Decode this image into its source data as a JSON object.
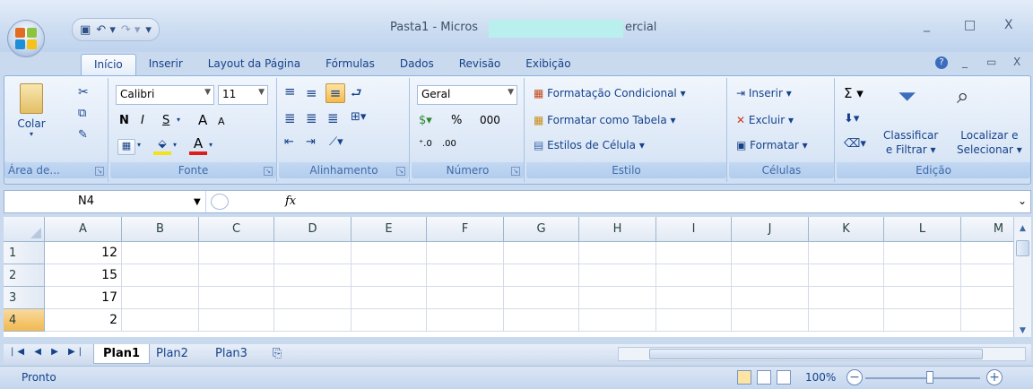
{
  "window": {
    "title_part1": "Pasta1 - Micros",
    "title_part2": "ercial",
    "minimize": "_",
    "maximize": "□",
    "close": "X"
  },
  "tabs": [
    "Início",
    "Inserir",
    "Layout da Página",
    "Fórmulas",
    "Dados",
    "Revisão",
    "Exibição"
  ],
  "ribbon": {
    "clipboard": {
      "paste": "Colar",
      "label": "Área de..."
    },
    "font": {
      "name": "Calibri",
      "size": "11",
      "bold": "N",
      "italic": "I",
      "underline": "S",
      "grow": "A",
      "shrink": "A",
      "label": "Fonte"
    },
    "alignment": {
      "label": "Alinhamento"
    },
    "number": {
      "format": "Geral",
      "percent": "%",
      "thousands": "000",
      "label": "Número"
    },
    "style": {
      "conditional": "Formatação Condicional",
      "table": "Formatar como Tabela",
      "cell_styles": "Estilos de Célula",
      "label": "Estilo"
    },
    "cells": {
      "insert": "Inserir",
      "delete": "Excluir",
      "format": "Formatar",
      "label": "Células"
    },
    "editing": {
      "sort1": "Classificar",
      "sort2": "e Filtrar",
      "find1": "Localizar e",
      "find2": "Selecionar",
      "sigma": "Σ",
      "label": "Edição"
    }
  },
  "formula_bar": {
    "name_box": "N4",
    "fx": "fx",
    "formula": ""
  },
  "grid": {
    "columns": [
      "A",
      "B",
      "C",
      "D",
      "E",
      "F",
      "G",
      "H",
      "I",
      "J",
      "K",
      "L",
      "M"
    ],
    "rows": [
      "1",
      "2",
      "3",
      "4"
    ],
    "values": [
      "12",
      "15",
      "17",
      "2"
    ]
  },
  "sheets": [
    "Plan1",
    "Plan2",
    "Plan3"
  ],
  "status": {
    "text": "Pronto",
    "zoom": "100%",
    "minus": "−",
    "plus": "+"
  },
  "colors": {
    "accent": "#15428b",
    "selected_row": "#f1b950",
    "ribbon": "#dbe7f6"
  }
}
